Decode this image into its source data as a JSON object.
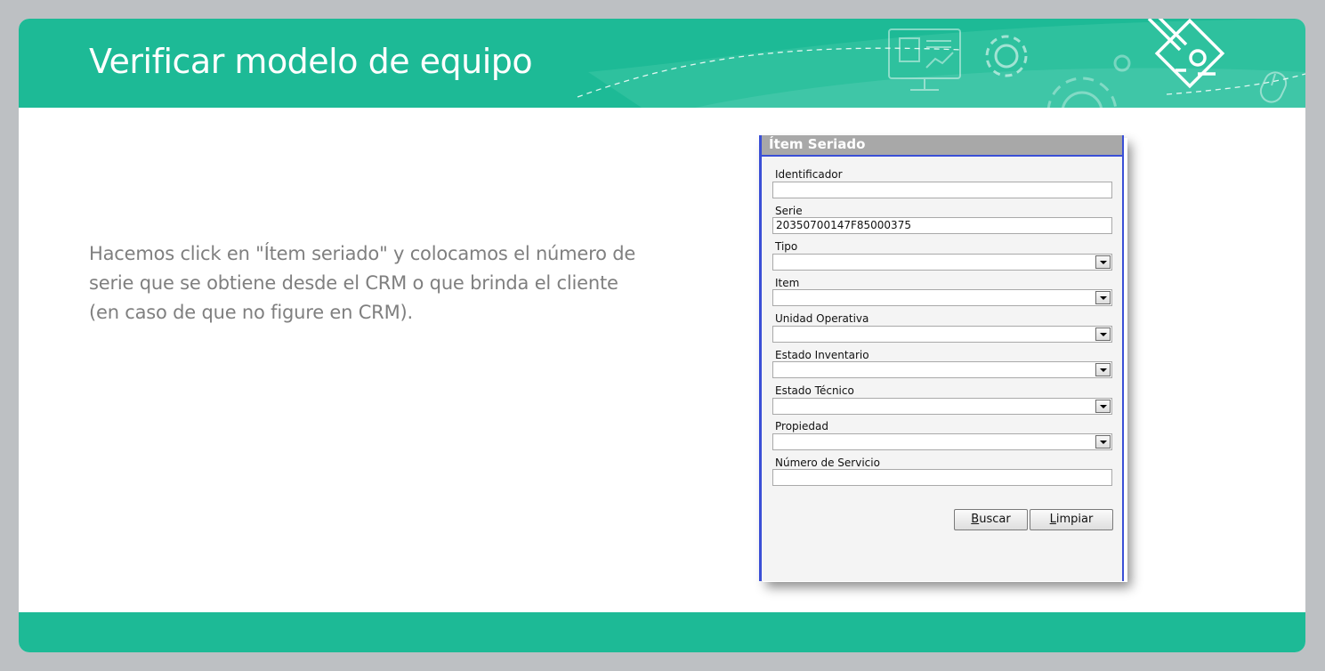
{
  "slide": {
    "title": "Verificar modelo de equipo",
    "description_lines": [
      "Hacemos click en \"Ítem seriado\" y colocamos el número de",
      "serie que se obtiene desde el CRM o que brinda el cliente",
      "(en caso de que no figure en CRM)."
    ]
  },
  "colors": {
    "brand_green": "#1dba96",
    "panel_border": "#3a4fd6",
    "background": "#bdc0c3"
  },
  "header_icons": [
    "presentation-screen-icon",
    "gear-icon",
    "large-gear-icon",
    "mouse-icon",
    "idea-pencil-diamond-icon"
  ],
  "panel": {
    "title": "Ítem Seriado",
    "fields": [
      {
        "label": "Identificador",
        "type": "text",
        "value": ""
      },
      {
        "label": "Serie",
        "type": "text",
        "value": "20350700147F85000375"
      },
      {
        "label": "Tipo",
        "type": "select",
        "value": ""
      },
      {
        "label": "Item",
        "type": "select",
        "value": ""
      },
      {
        "label": "Unidad Operativa",
        "type": "select",
        "value": ""
      },
      {
        "label": "Estado Inventario",
        "type": "select",
        "value": ""
      },
      {
        "label": "Estado Técnico",
        "type": "select",
        "value": ""
      },
      {
        "label": "Propiedad",
        "type": "select",
        "value": ""
      },
      {
        "label": "Número de Servicio",
        "type": "text",
        "value": ""
      }
    ],
    "buttons": {
      "search_accesskey": "B",
      "search_rest": "uscar",
      "clear_accesskey": "L",
      "clear_rest": "impiar"
    }
  }
}
